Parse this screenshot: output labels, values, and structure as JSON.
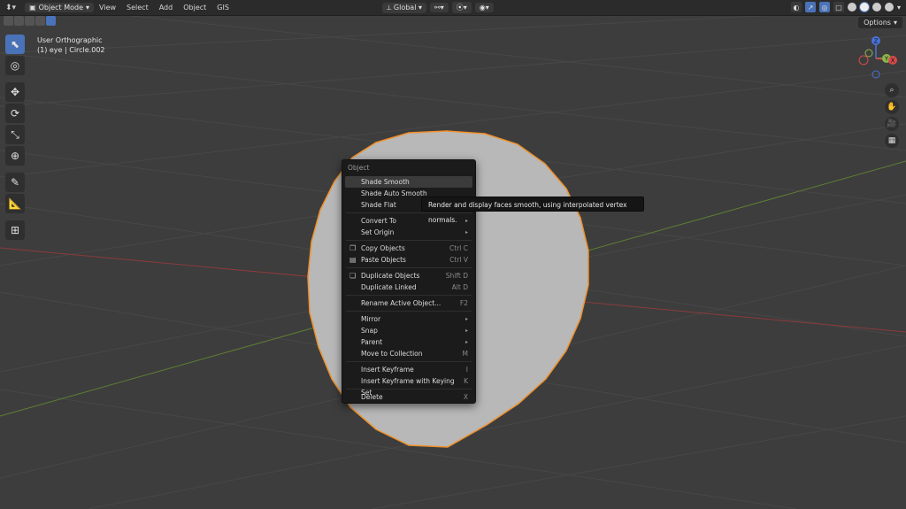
{
  "header": {
    "mode": "Object Mode",
    "menus": [
      "View",
      "Select",
      "Add",
      "Object",
      "GIS"
    ],
    "transform_orientation": "Global"
  },
  "options_label": "Options",
  "viewport": {
    "view_name": "User Orthographic",
    "object_info": "(1) eye | Circle.002"
  },
  "gizmo": {
    "z": "Z",
    "y": "Y",
    "x": "X"
  },
  "menu": {
    "title": "Object",
    "items": [
      {
        "label": "Shade Smooth",
        "shortcut": ""
      },
      {
        "label": "Shade Auto Smooth",
        "shortcut": ""
      },
      {
        "label": "Shade Flat",
        "shortcut": ""
      },
      {
        "label": "Convert To",
        "shortcut": "▸"
      },
      {
        "label": "Set Origin",
        "shortcut": "▸"
      },
      {
        "label": "Copy Objects",
        "shortcut": "Ctrl C"
      },
      {
        "label": "Paste Objects",
        "shortcut": "Ctrl V"
      },
      {
        "label": "Duplicate Objects",
        "shortcut": "Shift D"
      },
      {
        "label": "Duplicate Linked",
        "shortcut": "Alt D"
      },
      {
        "label": "Rename Active Object...",
        "shortcut": "F2"
      },
      {
        "label": "Mirror",
        "shortcut": "▸"
      },
      {
        "label": "Snap",
        "shortcut": "▸"
      },
      {
        "label": "Parent",
        "shortcut": "▸"
      },
      {
        "label": "Move to Collection",
        "shortcut": "M"
      },
      {
        "label": "Insert Keyframe",
        "shortcut": "I"
      },
      {
        "label": "Insert Keyframe with Keying Set",
        "shortcut": "K"
      },
      {
        "label": "Delete",
        "shortcut": "X"
      }
    ]
  },
  "tooltip": "Render and display faces smooth, using interpolated vertex normals.",
  "colors": {
    "accent": "#4a72b8",
    "selection_outline": "#f0902a",
    "x_axis": "#b84a4a",
    "y_axis": "#6a9a3a"
  }
}
